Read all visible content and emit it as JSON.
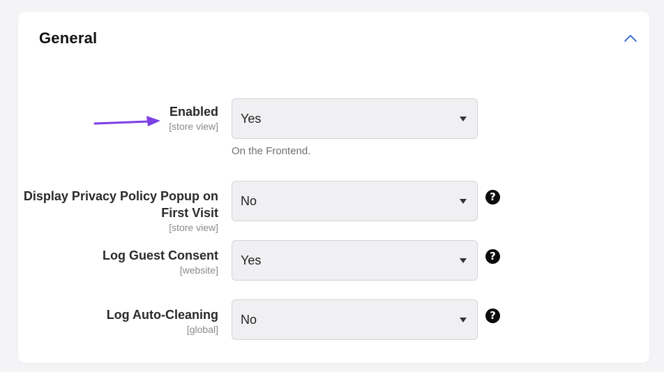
{
  "section": {
    "title": "General"
  },
  "colors": {
    "accent": "#1e5fd8",
    "arrow": "#7b3fe4"
  },
  "rows": [
    {
      "label": "Enabled",
      "scope": "[store view]",
      "selected": "Yes",
      "note": "On the Frontend.",
      "help": false
    },
    {
      "label_line1": "Display Privacy Policy Popup on",
      "label_line2": "First Visit",
      "scope": "[store view]",
      "selected": "No",
      "help": true
    },
    {
      "label": "Log Guest Consent",
      "scope": "[website]",
      "selected": "Yes",
      "help": true
    },
    {
      "label": "Log Auto-Cleaning",
      "scope": "[global]",
      "selected": "No",
      "help": true
    }
  ],
  "icons": {
    "collapse": "chevron-up-icon",
    "help": "question-circle-icon",
    "annotation": "arrow-right-icon",
    "dropdown": "caret-down-icon"
  },
  "help_glyph": "?"
}
